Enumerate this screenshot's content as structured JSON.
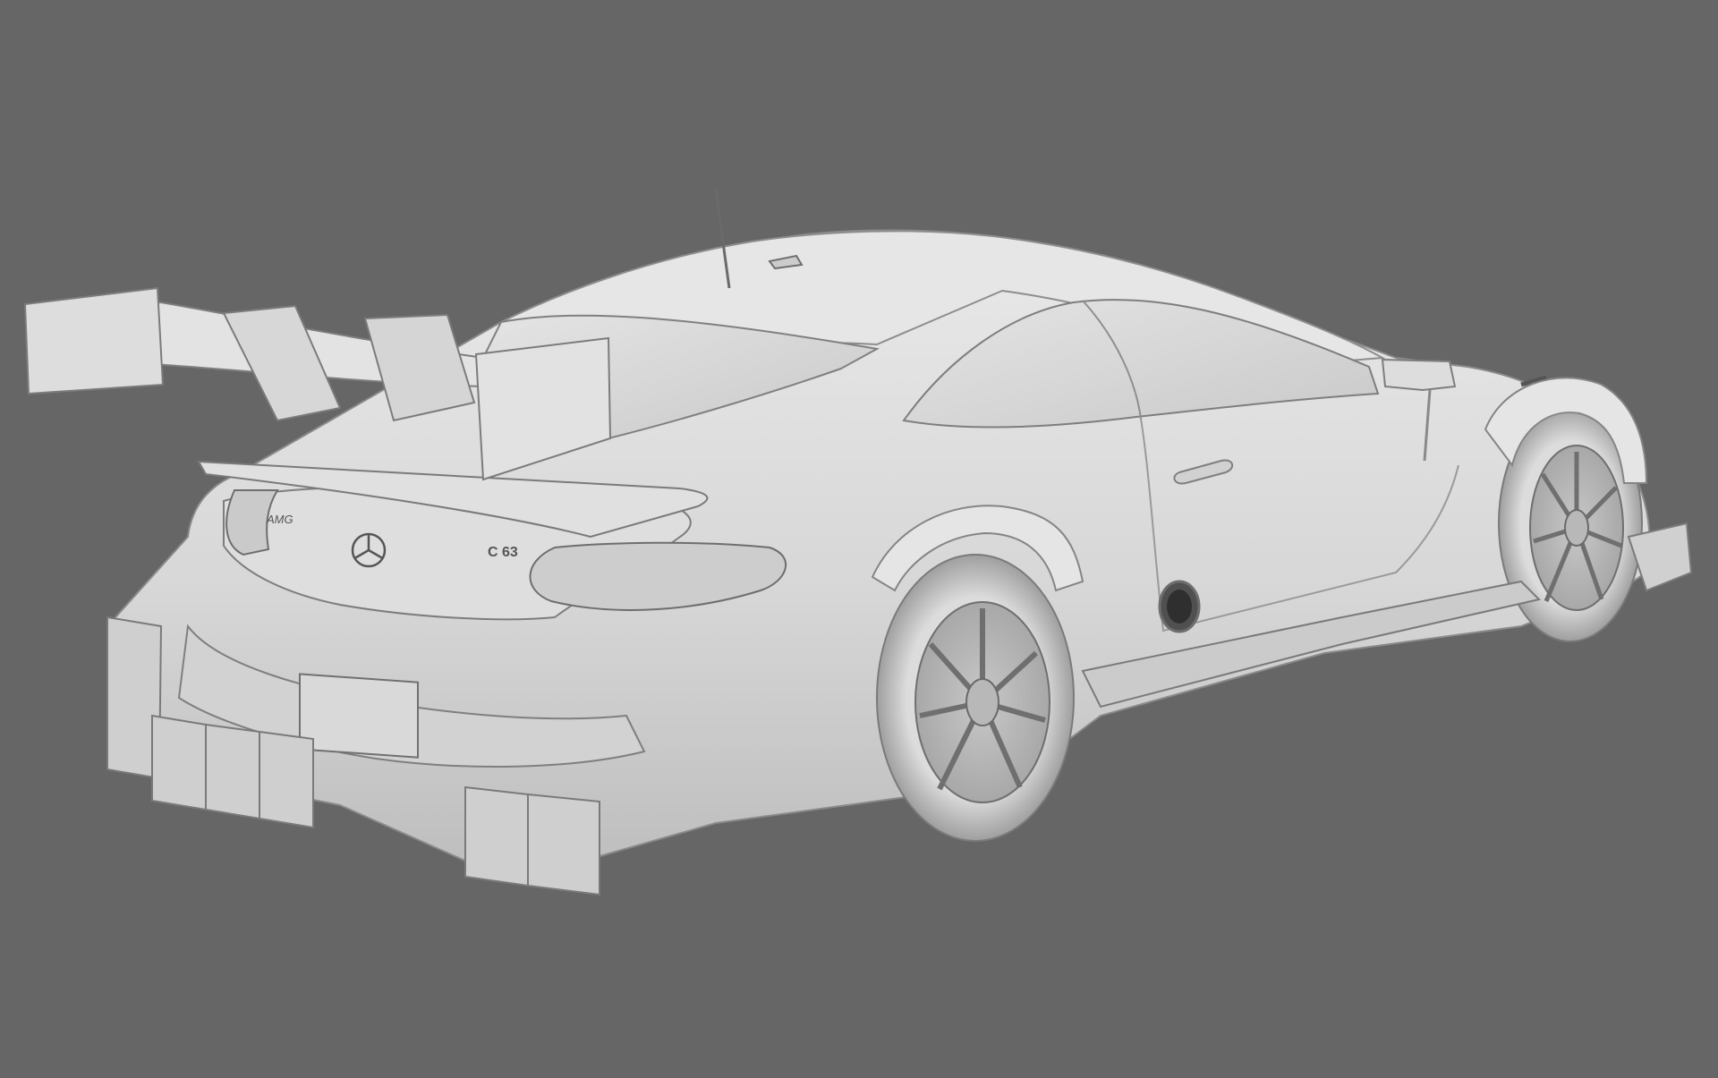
{
  "scene": {
    "subject": "race-car-3d-render",
    "background_color": "#666666",
    "body_color": "#d8d8d8",
    "shadow_color": "#a9a9a9",
    "line_color": "#7a7a7a",
    "badge_amg": "AMG",
    "badge_model": "C 63"
  }
}
